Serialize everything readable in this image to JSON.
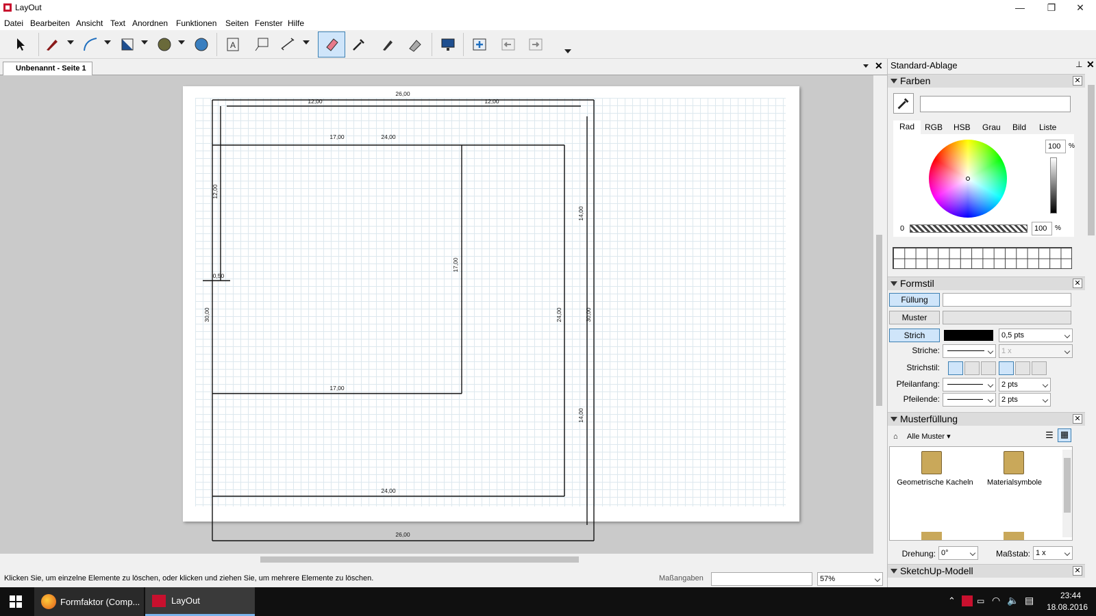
{
  "window": {
    "title": "LayOut",
    "minimize": "—",
    "maximize": "❐",
    "close": "✕"
  },
  "menu": [
    "Datei",
    "Bearbeiten",
    "Ansicht",
    "Text",
    "Anordnen",
    "Funktionen",
    "Seiten",
    "Fenster",
    "Hilfe"
  ],
  "tabs": {
    "doc_tab": "Unbenannt - Seite 1"
  },
  "drawing_dims": {
    "top_total": "26,00",
    "top_left": "12,00",
    "top_right": "12,00",
    "row2_a": "17,00",
    "row2_b": "24,00",
    "left_v": "12,00",
    "small": "0,50",
    "mid_v": "17,00",
    "right_v_top": "14,00",
    "right_v_bottom": "14,00",
    "inner_v": "24,00",
    "outer_v": "30,00",
    "outer_v_left": "30,00",
    "bottom_17": "17,00",
    "bottom_24": "24,00",
    "bottom_26": "26,00"
  },
  "status": {
    "hint": "Klicken Sie, um einzelne Elemente zu löschen, oder klicken und ziehen Sie, um mehrere Elemente zu löschen.",
    "measure_label": "Maßangaben",
    "zoom": "57%"
  },
  "panel": {
    "title": "Standard-Ablage",
    "farben": {
      "header": "Farben",
      "tabs": [
        "Rad",
        "RGB",
        "HSB",
        "Grau",
        "Bild",
        "Liste"
      ],
      "brightness": "100",
      "opacity": "100",
      "percent": "%",
      "zero": "0"
    },
    "formstil": {
      "header": "Formstil",
      "fill": "Füllung",
      "pattern": "Muster",
      "stroke": "Strich",
      "stroke_width": "0,5 pts",
      "dashes_label": "Striche:",
      "dash_scale": "1 x",
      "strokestyle_label": "Strichstil:",
      "arrow_start_label": "Pfeilanfang:",
      "arrow_end_label": "Pfeilende:",
      "arrow_start_size": "2 pts",
      "arrow_end_size": "2 pts"
    },
    "musterfuellung": {
      "header": "Musterfüllung",
      "filter": "Alle Muster",
      "items": [
        "Geometrische Kacheln",
        "Materialsymbole"
      ],
      "rotation_label": "Drehung:",
      "rotation": "0°",
      "scale_label": "Maßstab:",
      "scale": "1 x"
    },
    "sketchup": {
      "header": "SketchUp-Modell"
    }
  },
  "taskbar": {
    "firefox": "Formfaktor (Comp...",
    "layout": "LayOut",
    "time": "23:44",
    "date": "18.08.2016"
  },
  "colors": {
    "accent": "#3c7fb1",
    "taskbar": "#101010",
    "canvas_bg": "#cacaca"
  }
}
